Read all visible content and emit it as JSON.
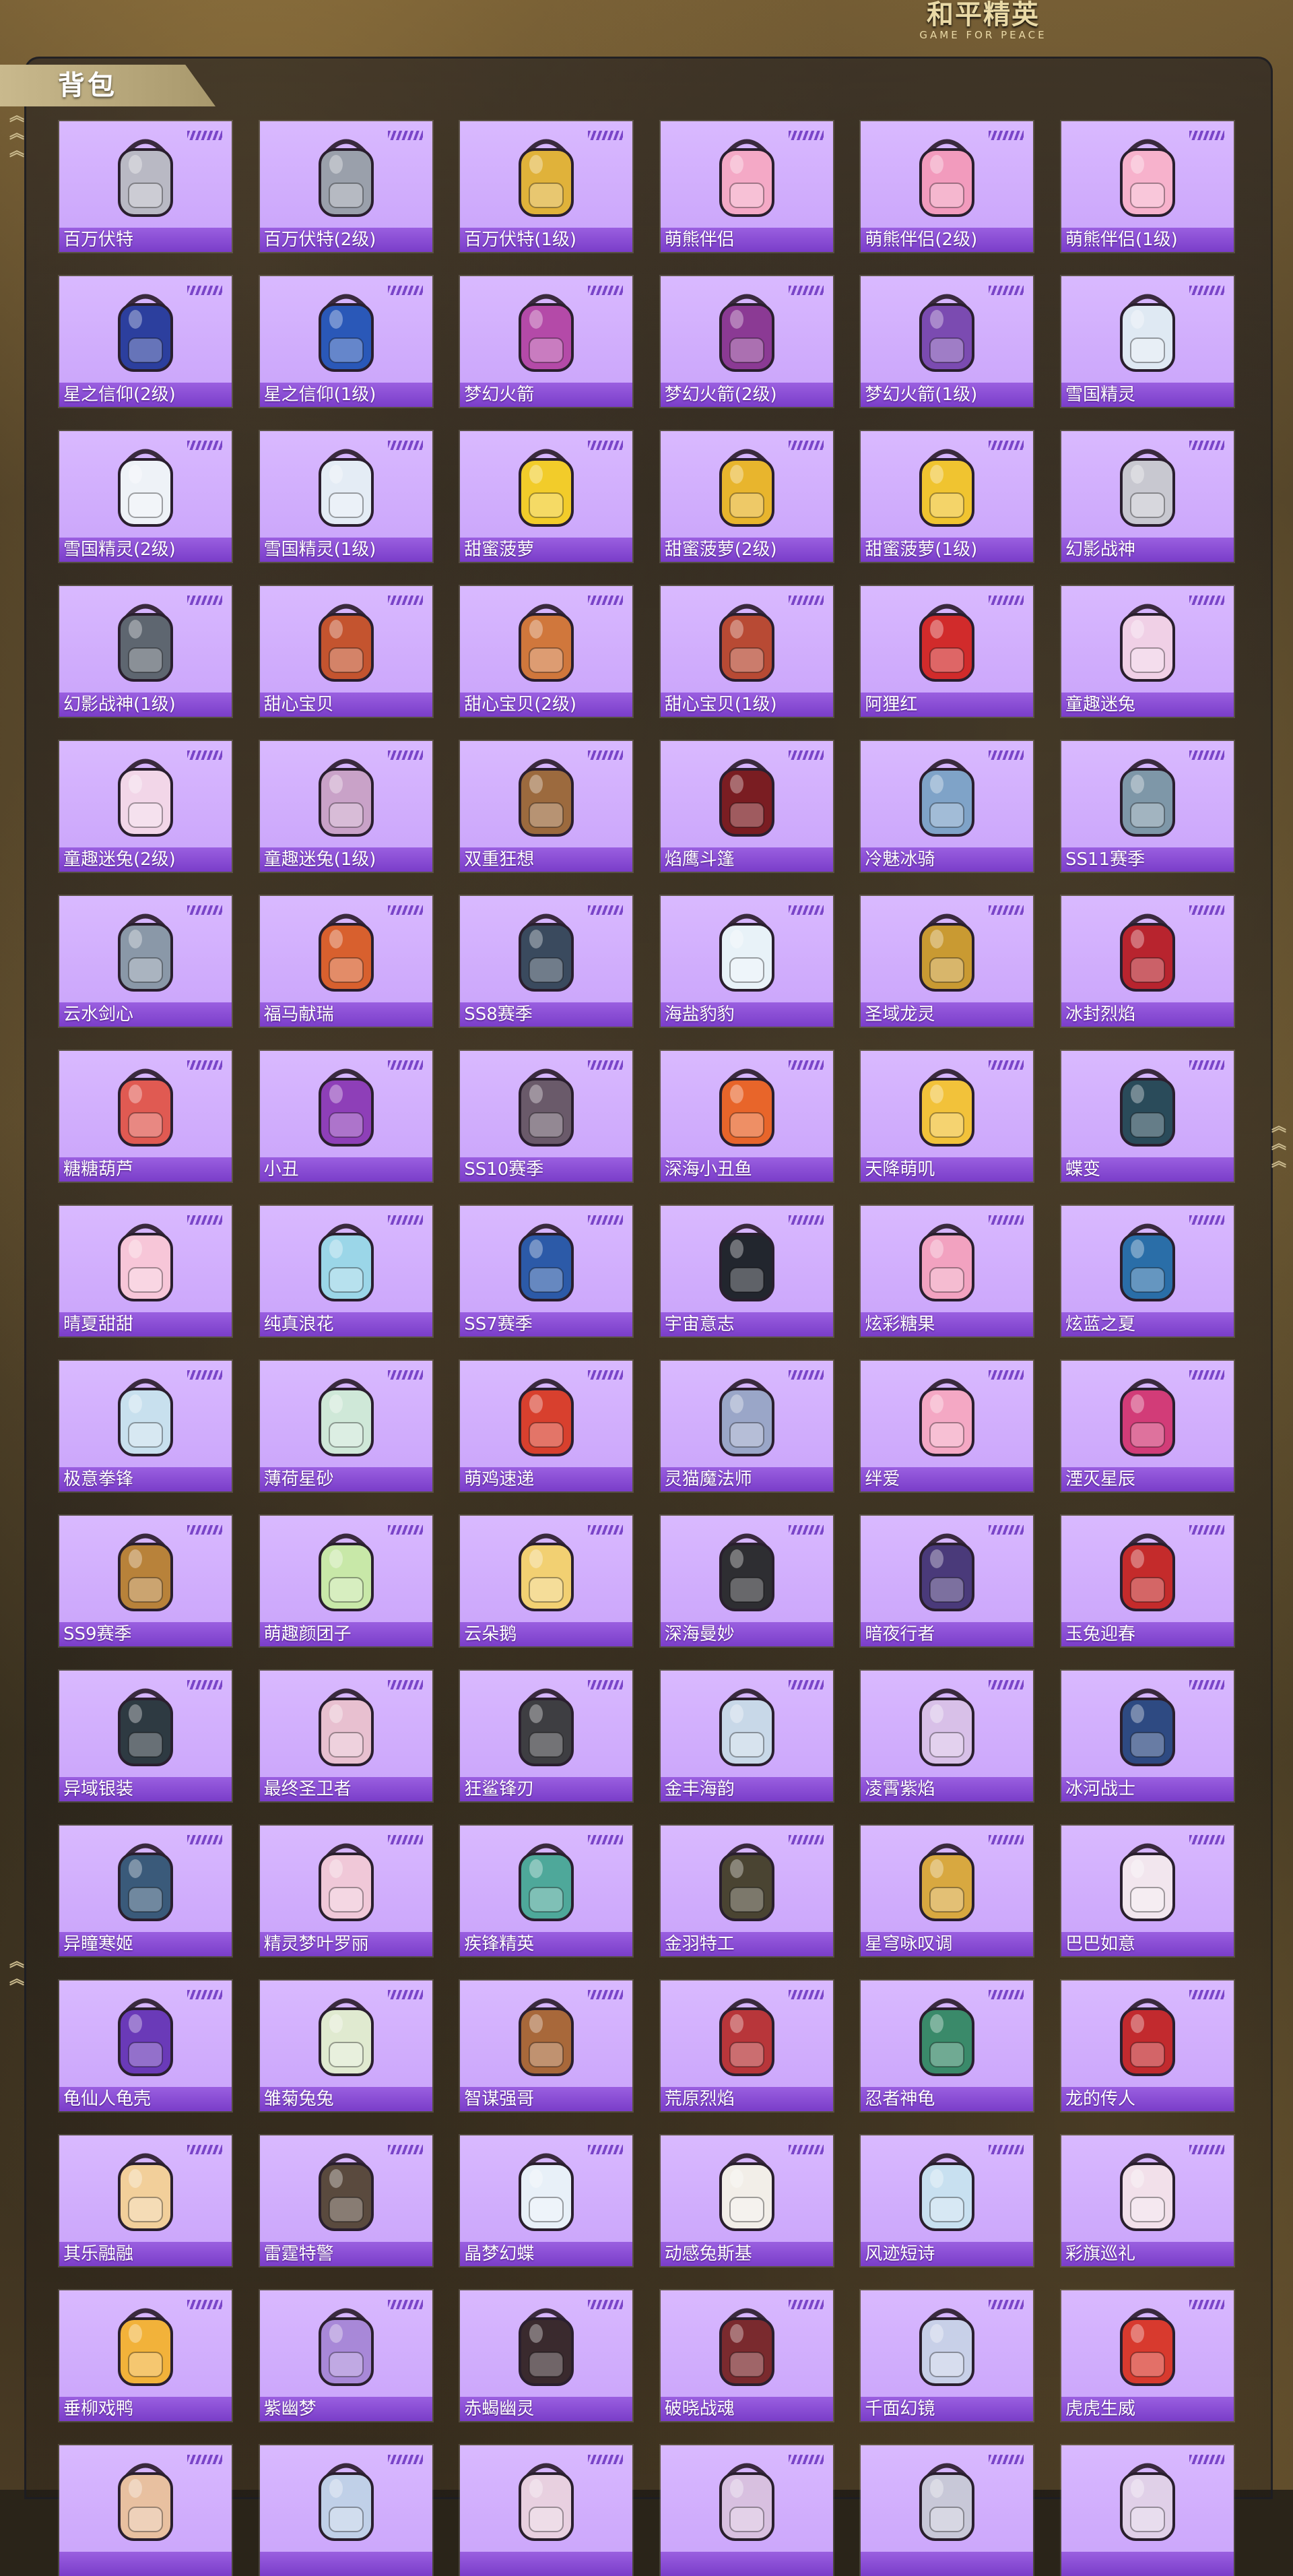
{
  "header": {
    "logo_cn": "和平精英",
    "logo_en": "GAME FOR PEACE"
  },
  "section": {
    "title": "背包"
  },
  "colors": {
    "card_bg": "#d9b9ff",
    "label_bg": "#8a4fd6",
    "accent": "#c9b98d"
  },
  "backpacks": [
    {
      "name": "百万伏特",
      "color": "#b9b9c4"
    },
    {
      "name": "百万伏特(2级)",
      "color": "#9aa0ab"
    },
    {
      "name": "百万伏特(1级)",
      "color": "#e0b23a"
    },
    {
      "name": "萌熊伴侣",
      "color": "#f4a9c6"
    },
    {
      "name": "萌熊伴侣(2级)",
      "color": "#f29bbd"
    },
    {
      "name": "萌熊伴侣(1级)",
      "color": "#f7b2cc"
    },
    {
      "name": "星之信仰(2级)",
      "color": "#2c3f9e"
    },
    {
      "name": "星之信仰(1级)",
      "color": "#2a58b8"
    },
    {
      "name": "梦幻火箭",
      "color": "#b44aa8"
    },
    {
      "name": "梦幻火箭(2级)",
      "color": "#8b3a94"
    },
    {
      "name": "梦幻火箭(1级)",
      "color": "#7b4bb1"
    },
    {
      "name": "雪国精灵",
      "color": "#dfe9f3"
    },
    {
      "name": "雪国精灵(2级)",
      "color": "#eef2f7"
    },
    {
      "name": "雪国精灵(1级)",
      "color": "#e4ecf5"
    },
    {
      "name": "甜蜜菠萝",
      "color": "#f2cc2a"
    },
    {
      "name": "甜蜜菠萝(2级)",
      "color": "#e8b52d"
    },
    {
      "name": "甜蜜菠萝(1级)",
      "color": "#f0c430"
    },
    {
      "name": "幻影战神",
      "color": "#c8c8d0"
    },
    {
      "name": "幻影战神(1级)",
      "color": "#5e6670"
    },
    {
      "name": "甜心宝贝",
      "color": "#c4542f"
    },
    {
      "name": "甜心宝贝(2级)",
      "color": "#d0773c"
    },
    {
      "name": "甜心宝贝(1级)",
      "color": "#b84a34"
    },
    {
      "name": "阿狸红",
      "color": "#d12b2b"
    },
    {
      "name": "童趣迷兔",
      "color": "#f0d0e6"
    },
    {
      "name": "童趣迷兔(2级)",
      "color": "#f2d6e8"
    },
    {
      "name": "童趣迷兔(1级)",
      "color": "#c9a2c8"
    },
    {
      "name": "双重狂想",
      "color": "#9c6a3e"
    },
    {
      "name": "焰鹰斗篷",
      "color": "#7a1d22"
    },
    {
      "name": "冷魅冰骑",
      "color": "#7fa3c8"
    },
    {
      "name": "SS11赛季",
      "color": "#7e97a8"
    },
    {
      "name": "云水剑心",
      "color": "#8a98a8"
    },
    {
      "name": "福马献瑞",
      "color": "#d8602e"
    },
    {
      "name": "SS8赛季",
      "color": "#3a4a5e"
    },
    {
      "name": "海盐豹豹",
      "color": "#e8f2f8"
    },
    {
      "name": "圣域龙灵",
      "color": "#c99a32"
    },
    {
      "name": "冰封烈焰",
      "color": "#b8242e"
    },
    {
      "name": "糖糖葫芦",
      "color": "#e05a52"
    },
    {
      "name": "小丑",
      "color": "#8e3fb8"
    },
    {
      "name": "SS10赛季",
      "color": "#6a5a6a"
    },
    {
      "name": "深海小丑鱼",
      "color": "#e8652a"
    },
    {
      "name": "天降萌叽",
      "color": "#f2c23a"
    },
    {
      "name": "蝶变",
      "color": "#2a4b5a"
    },
    {
      "name": "晴夏甜甜",
      "color": "#f7c6d8"
    },
    {
      "name": "纯真浪花",
      "color": "#9bd6e8"
    },
    {
      "name": "SS7赛季",
      "color": "#2c5aa8"
    },
    {
      "name": "宇宙意志",
      "color": "#22262e"
    },
    {
      "name": "炫彩糖果",
      "color": "#f2a2c0"
    },
    {
      "name": "炫蓝之夏",
      "color": "#2a6ea8"
    },
    {
      "name": "极意拳锋",
      "color": "#c8e0ee"
    },
    {
      "name": "薄荷星砂",
      "color": "#cfe8d8"
    },
    {
      "name": "萌鸡速递",
      "color": "#d8402e"
    },
    {
      "name": "灵猫魔法师",
      "color": "#9aa6c8"
    },
    {
      "name": "绊爱",
      "color": "#f4a8c4"
    },
    {
      "name": "湮灭星辰",
      "color": "#d23c78"
    },
    {
      "name": "SS9赛季",
      "color": "#b8823a"
    },
    {
      "name": "萌趣颜团子",
      "color": "#c8e8a8"
    },
    {
      "name": "云朵鹅",
      "color": "#f2d072"
    },
    {
      "name": "深海曼妙",
      "color": "#2e2e32"
    },
    {
      "name": "暗夜行者",
      "color": "#4a3a7a"
    },
    {
      "name": "玉兔迎春",
      "color": "#c42b2b"
    },
    {
      "name": "异域银装",
      "color": "#2e3a42"
    },
    {
      "name": "最终圣卫者",
      "color": "#e8c0d0"
    },
    {
      "name": "狂鲨锋刃",
      "color": "#3e3e42"
    },
    {
      "name": "金丰海韵",
      "color": "#c8d8e8"
    },
    {
      "name": "凌霄紫焰",
      "color": "#d8c0e8"
    },
    {
      "name": "冰河战士",
      "color": "#2e4a82"
    },
    {
      "name": "异瞳寒姬",
      "color": "#3a5a7a"
    },
    {
      "name": "精灵梦叶罗丽",
      "color": "#f0c8d8"
    },
    {
      "name": "疾锋精英",
      "color": "#4ea89a"
    },
    {
      "name": "金羽特工",
      "color": "#4a4432"
    },
    {
      "name": "星穹咏叹调",
      "color": "#d8a840"
    },
    {
      "name": "巴巴如意",
      "color": "#f2e6ee"
    },
    {
      "name": "龟仙人龟壳",
      "color": "#6a3ab8"
    },
    {
      "name": "雏菊兔兔",
      "color": "#e0ead0"
    },
    {
      "name": "智谋强哥",
      "color": "#a8683a"
    },
    {
      "name": "荒原烈焰",
      "color": "#b8363a"
    },
    {
      "name": "忍者神龟",
      "color": "#3a8a6a"
    },
    {
      "name": "龙的传人",
      "color": "#c22a2e"
    },
    {
      "name": "其乐融融",
      "color": "#f2cf9a"
    },
    {
      "name": "雷霆特警",
      "color": "#5a4a3e"
    },
    {
      "name": "晶梦幻蝶",
      "color": "#e8f0f8"
    },
    {
      "name": "动感兔斯基",
      "color": "#f2eee8"
    },
    {
      "name": "风迹短诗",
      "color": "#c8e0f0"
    },
    {
      "name": "彩旗巡礼",
      "color": "#f2e0ea"
    },
    {
      "name": "垂柳戏鸭",
      "color": "#f2b23a"
    },
    {
      "name": "紫幽梦",
      "color": "#a888d8"
    },
    {
      "name": "赤蝎幽灵",
      "color": "#3a2a2e"
    },
    {
      "name": "破晓战魂",
      "color": "#7a2a2e"
    },
    {
      "name": "千面幻镜",
      "color": "#c8d0e8"
    },
    {
      "name": "虎虎生威",
      "color": "#d83a2e"
    },
    {
      "name": "",
      "color": "#e8c0a0"
    },
    {
      "name": "",
      "color": "#c0d0e8"
    },
    {
      "name": "",
      "color": "#e8d0e0"
    },
    {
      "name": "",
      "color": "#d8c0e0"
    },
    {
      "name": "",
      "color": "#c8c8d8"
    },
    {
      "name": "",
      "color": "#e0d0e8"
    }
  ]
}
